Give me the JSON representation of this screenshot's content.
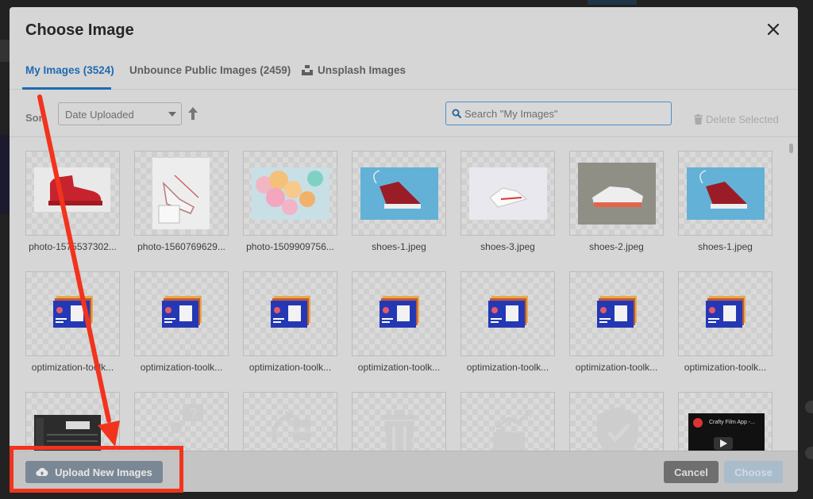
{
  "modal": {
    "title": "Choose Image"
  },
  "tabs": [
    {
      "label": "My Images (3524)",
      "active": true
    },
    {
      "label": "Unbounce Public Images (2459)",
      "active": false
    },
    {
      "label": "Unsplash Images",
      "active": false,
      "icon": "unsplash-icon"
    }
  ],
  "toolbar": {
    "sort_label": "Sort",
    "sort_value": "Date Uploaded",
    "sort_direction_icon": "arrow-up-icon",
    "search_placeholder": "Search \"My Images\"",
    "delete_label": "Delete Selected"
  },
  "images": [
    {
      "caption": "photo-1575537302...",
      "kind": "red-boot"
    },
    {
      "caption": "photo-1560769629...",
      "kind": "sneaker-hang"
    },
    {
      "caption": "photo-1509909756...",
      "kind": "balloons"
    },
    {
      "caption": "shoes-1.jpeg",
      "kind": "red-sneaker-blue"
    },
    {
      "caption": "shoes-3.jpeg",
      "kind": "white-sneaker"
    },
    {
      "caption": "shoes-2.jpeg",
      "kind": "orange-sneaker"
    },
    {
      "caption": "shoes-1.jpeg",
      "kind": "red-sneaker-blue"
    },
    {
      "caption": "optimization-toolk...",
      "kind": "toolkit"
    },
    {
      "caption": "optimization-toolk...",
      "kind": "toolkit"
    },
    {
      "caption": "optimization-toolk...",
      "kind": "toolkit"
    },
    {
      "caption": "optimization-toolk...",
      "kind": "toolkit"
    },
    {
      "caption": "optimization-toolk...",
      "kind": "toolkit"
    },
    {
      "caption": "optimization-toolk...",
      "kind": "toolkit"
    },
    {
      "caption": "optimization-toolk...",
      "kind": "toolkit"
    },
    {
      "caption": "",
      "kind": "screenshot-dark"
    },
    {
      "caption": "",
      "kind": "icon-question"
    },
    {
      "caption": "",
      "kind": "icon-refresh"
    },
    {
      "caption": "",
      "kind": "icon-trash"
    },
    {
      "caption": "",
      "kind": "icon-chart"
    },
    {
      "caption": "",
      "kind": "icon-shield"
    },
    {
      "caption": "",
      "kind": "video-thumb",
      "video_title": "Crafty Film App -..."
    }
  ],
  "footer": {
    "upload_label": "Upload New Images",
    "cancel_label": "Cancel",
    "choose_label": "Choose"
  },
  "colors": {
    "accent": "#1f6bb0",
    "annotation": "#f2331d"
  }
}
